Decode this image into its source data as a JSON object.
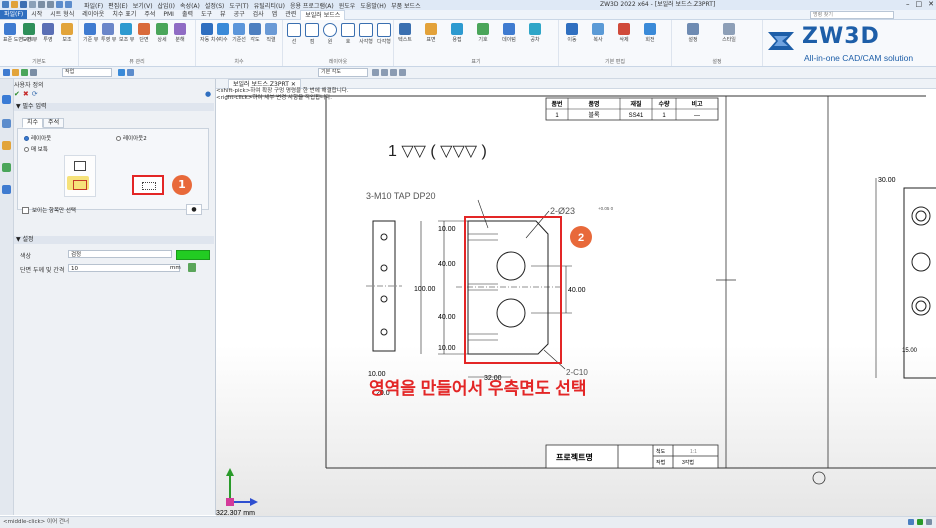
{
  "app": {
    "window_title": "ZW3D 2022 x64 - [보일러 보드스.Z3PRT]",
    "menus": [
      "파일(F)",
      "편집(E)",
      "보기(V)",
      "삽입(I)",
      "속성(A)",
      "설정(S)",
      "도구(T)",
      "유틸리티(U)",
      "응용 프로그램(A)",
      "윈도우",
      "도움말(H)",
      "부품 보드스"
    ]
  },
  "ribbon": {
    "file_tab": "파일(F)",
    "tabs": [
      "시작",
      "시트 형식",
      "레이아웃",
      "치수 표기",
      "주석",
      "PMI",
      "출력",
      "도구",
      "뷰",
      "공구",
      "검사",
      "앱",
      "관련",
      "보일러 보드스"
    ],
    "active_tab": "보일러 보드스",
    "search_placeholder": "명령 찾기",
    "groups": [
      {
        "label": "기본도",
        "buttons": [
          "표준 도면 시트",
          "도면 뷰",
          "투영",
          "보조"
        ]
      },
      {
        "label": "뷰 관리",
        "buttons": [
          "기준 뷰",
          "투영 뷰",
          "보조 뷰",
          "단면",
          "상세",
          "분해"
        ]
      },
      {
        "label": "치수",
        "buttons": [
          "자동 치수",
          "치수",
          "기준선",
          "각도",
          "직렬"
        ]
      },
      {
        "label": "레이아웃",
        "buttons": [
          "선",
          "점",
          "원",
          "호",
          "사각형",
          "다각형"
        ]
      },
      {
        "label": "표기",
        "buttons": [
          "텍스트",
          "표면",
          "용접",
          "기호",
          "데이텀",
          "공차"
        ]
      },
      {
        "label": "기본 편집",
        "buttons": [
          "이동",
          "복사",
          "삭제",
          "회전"
        ]
      },
      {
        "label": "설정",
        "buttons": [
          "설정",
          "스타일"
        ]
      }
    ]
  },
  "brand": {
    "name": "ZW3D",
    "tagline": "All-in-one CAD/CAM solution",
    "color": "#1d5ea8"
  },
  "subtoolbar": {
    "filter_value": "작업",
    "view_value": "기본 각도"
  },
  "left_panel": {
    "strip_title": "사용자 정의",
    "section_main": "필수 입력",
    "tabs": [
      "치수",
      "주석"
    ],
    "active_tab": "치수",
    "radio_options": [
      "레이아웃",
      "레이아웃2",
      "매 보특"
    ],
    "selected_radio": 0,
    "checkbox_label": "보이는 항목만 선택",
    "section_settings": "설정",
    "fields": [
      {
        "label": "색상",
        "value": "검정",
        "swatch": "#22cc22"
      },
      {
        "label": "단면 두께 및 간격",
        "value": "10",
        "unit": "mm"
      }
    ],
    "annotation_1": "1"
  },
  "document": {
    "tab_name": "보일러 보드스.Z3PRT",
    "hint_line_1": "<shift-pick>하여 확장 구멍 명령을 한 번에 해결합니다.",
    "hint_line_2": "<right-click>하여 세부 변경 사항을 작업합니다."
  },
  "drawing": {
    "title_table_headers": [
      "품번",
      "품명",
      "재질",
      "수량",
      "비고"
    ],
    "title_table_row": [
      "1",
      "블록",
      "SS41",
      "1",
      "—"
    ],
    "roughness_text": "1  ▽▽  (  ▽▽▽  )",
    "tap_callout": "3-M10 TAP DP20",
    "hole_callout": "2-Ø23",
    "hole_tol": "+0.05\n0",
    "chamfer_callout": "2-C10",
    "dims_left": [
      "10.00",
      "40.00",
      "40.00",
      "100.00",
      "10.00"
    ],
    "dim_right": "40.00",
    "dim_bottom_left": "10.00",
    "dim_bottom": "32.00",
    "dim_partial": "20.0",
    "right_view_dims": [
      "30.00",
      "15.00"
    ],
    "project_label": "프로젝트명",
    "title_cells": [
      "척도",
      "1:1",
      "작법",
      "3각법"
    ],
    "annotation_2": "2",
    "overlay_caption": "영역을 만들어서 우측면도 선택",
    "coord_readout": "322.307 mm"
  },
  "status_bar": {
    "hint": "<middle-click> 이어 건너"
  },
  "colors": {
    "highlight_red": "#e32626",
    "badge_orange": "#e8693a",
    "ribbon_blue": "#2f6fc0"
  }
}
